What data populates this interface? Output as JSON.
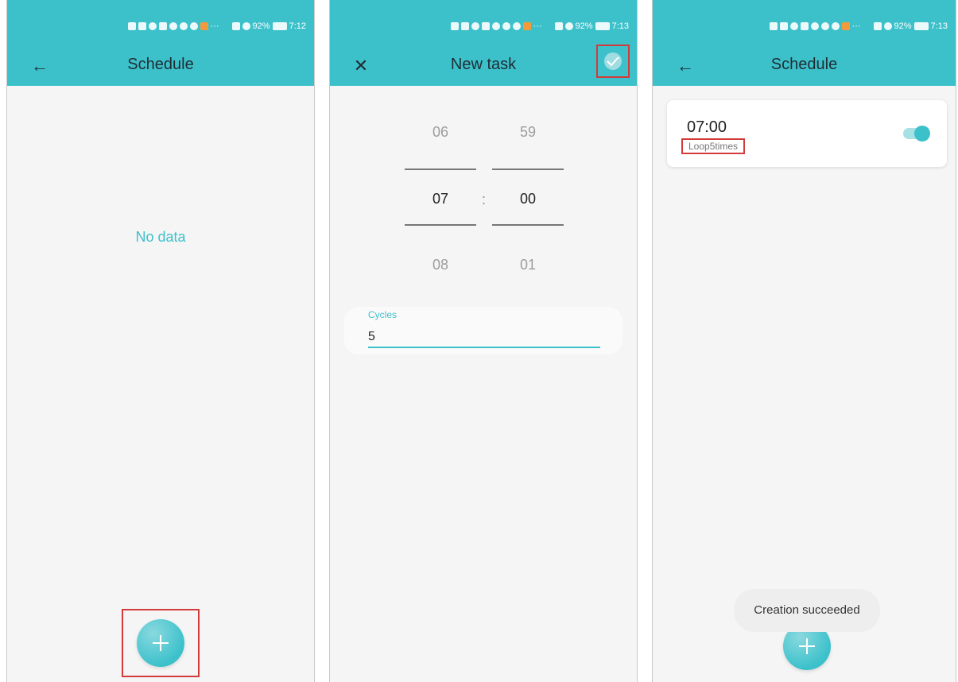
{
  "screens": [
    {
      "status": {
        "battery": "92%",
        "time": "7:12",
        "more": "···"
      },
      "title": "Schedule",
      "nav_icon": "arrow-left-icon",
      "empty_text": "No data"
    },
    {
      "status": {
        "battery": "92%",
        "time": "7:13",
        "more": "···"
      },
      "title": "New task",
      "nav_icon": "close-icon",
      "confirm_icon": "check-icon",
      "picker": {
        "hours": {
          "prev": "06",
          "selected": "07",
          "next": "08"
        },
        "minutes": {
          "prev": "59",
          "selected": "00",
          "next": "01"
        },
        "separator": ":"
      },
      "cycles": {
        "label": "Cycles",
        "value": "5"
      }
    },
    {
      "status": {
        "battery": "92%",
        "time": "7:13",
        "more": "···"
      },
      "title": "Schedule",
      "nav_icon": "arrow-left-icon",
      "schedule_item": {
        "time": "07:00",
        "subtitle": "Loop5times",
        "enabled": true
      },
      "toast": "Creation succeeded"
    }
  ],
  "colors": {
    "accent": "#3cc1cb",
    "highlight": "#d33a3a",
    "background": "#f5f5f5"
  }
}
